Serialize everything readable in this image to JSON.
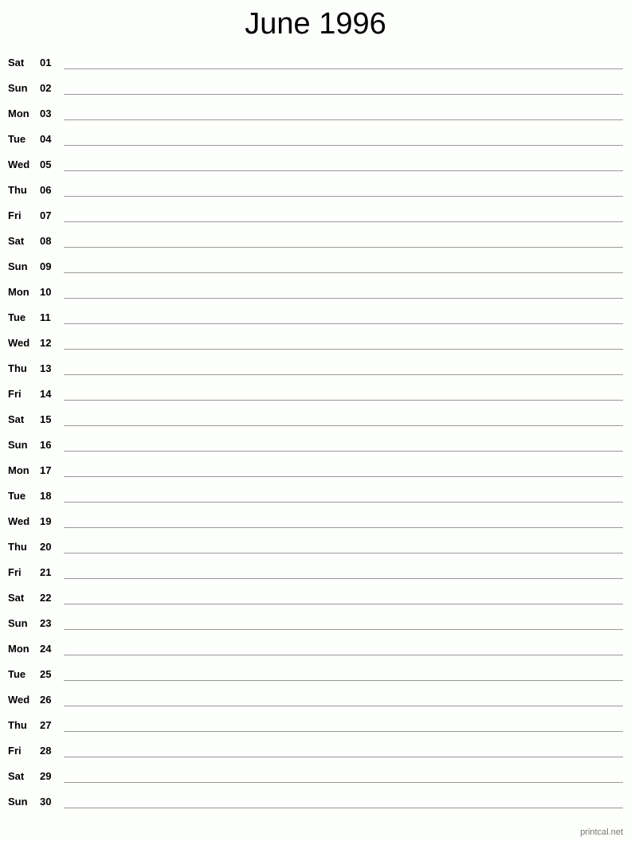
{
  "title": "June 1996",
  "days": [
    {
      "day": "Sat",
      "num": "01"
    },
    {
      "day": "Sun",
      "num": "02"
    },
    {
      "day": "Mon",
      "num": "03"
    },
    {
      "day": "Tue",
      "num": "04"
    },
    {
      "day": "Wed",
      "num": "05"
    },
    {
      "day": "Thu",
      "num": "06"
    },
    {
      "day": "Fri",
      "num": "07"
    },
    {
      "day": "Sat",
      "num": "08"
    },
    {
      "day": "Sun",
      "num": "09"
    },
    {
      "day": "Mon",
      "num": "10"
    },
    {
      "day": "Tue",
      "num": "11"
    },
    {
      "day": "Wed",
      "num": "12"
    },
    {
      "day": "Thu",
      "num": "13"
    },
    {
      "day": "Fri",
      "num": "14"
    },
    {
      "day": "Sat",
      "num": "15"
    },
    {
      "day": "Sun",
      "num": "16"
    },
    {
      "day": "Mon",
      "num": "17"
    },
    {
      "day": "Tue",
      "num": "18"
    },
    {
      "day": "Wed",
      "num": "19"
    },
    {
      "day": "Thu",
      "num": "20"
    },
    {
      "day": "Fri",
      "num": "21"
    },
    {
      "day": "Sat",
      "num": "22"
    },
    {
      "day": "Sun",
      "num": "23"
    },
    {
      "day": "Mon",
      "num": "24"
    },
    {
      "day": "Tue",
      "num": "25"
    },
    {
      "day": "Wed",
      "num": "26"
    },
    {
      "day": "Thu",
      "num": "27"
    },
    {
      "day": "Fri",
      "num": "28"
    },
    {
      "day": "Sat",
      "num": "29"
    },
    {
      "day": "Sun",
      "num": "30"
    }
  ],
  "footer": "printcal.net"
}
